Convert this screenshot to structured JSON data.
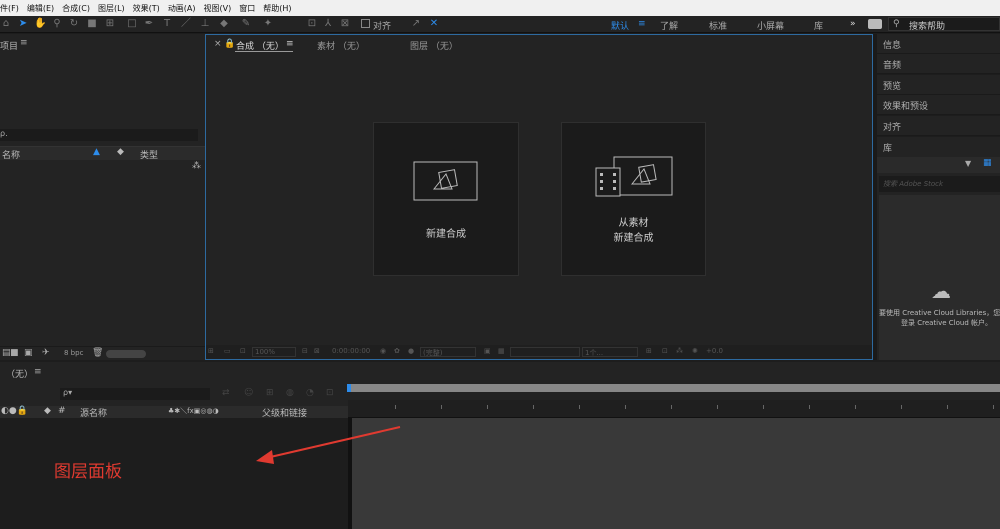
{
  "menu": [
    "件(F)",
    "编辑(E)",
    "合成(C)",
    "图层(L)",
    "效果(T)",
    "动画(A)",
    "视图(V)",
    "窗口",
    "帮助(H)"
  ],
  "toolbar": {
    "align_label": "对齐",
    "workspaces": [
      "默认",
      "了解",
      "标准",
      "小屏幕",
      "库"
    ],
    "more": "»",
    "search_placeholder": "搜索帮助"
  },
  "project": {
    "title": "项目",
    "search_icon": "ρ.",
    "col_name": "名称",
    "col_type": "类型",
    "bpc": "8 bpc"
  },
  "comp": {
    "tabs": [
      "合成 （无）",
      "素材 （无）",
      "图层 （无）"
    ],
    "new_comp": "新建合成",
    "from_footage_line1": "从素材",
    "from_footage_line2": "新建合成",
    "zoom": "100%",
    "timecode": "0:00:00:00",
    "quality": "(完整)",
    "view": "1个...",
    "offset": "+0.0"
  },
  "right": {
    "items": [
      "信息",
      "音频",
      "预览",
      "效果和预设",
      "对齐",
      "库"
    ],
    "search_placeholder": "搜索 Adobe Stock",
    "cloud_msg1": "要使用 Creative Cloud Libraries，您需",
    "cloud_msg2": "登录 Creative Cloud 帐户。"
  },
  "timeline": {
    "title": "（无）",
    "source_name": "源名称",
    "parent": "父级和链接",
    "hash": "#"
  },
  "annotation": {
    "text": "图层面板",
    "color": "#e03a30"
  },
  "colors": {
    "accent": "#2d8ceb",
    "panel": "#232323",
    "bg": "#1d1d1d"
  }
}
